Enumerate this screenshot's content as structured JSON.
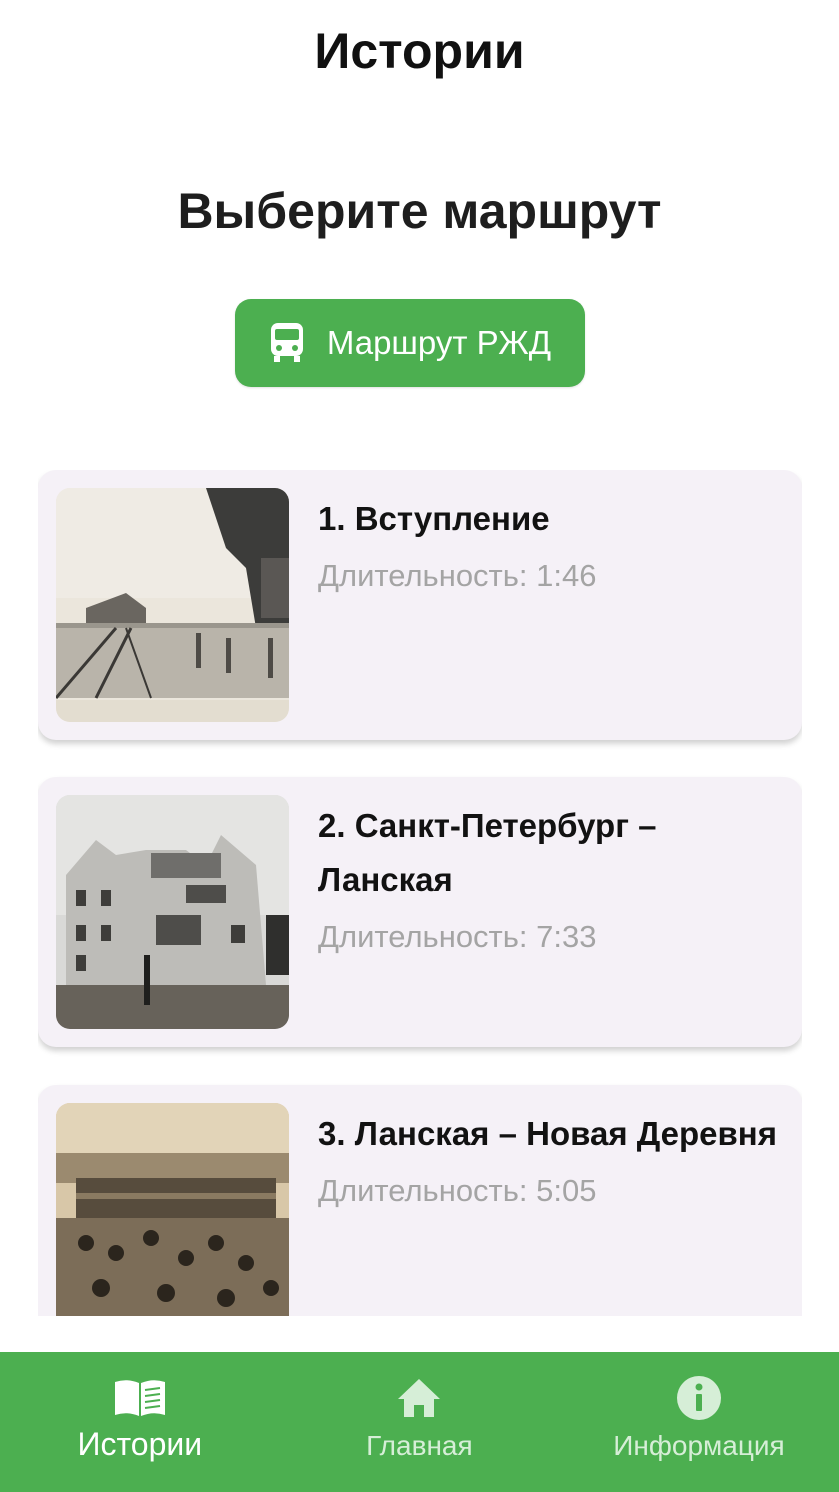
{
  "header": {
    "title": "Истории"
  },
  "section": {
    "title": "Выберите маршрут"
  },
  "route_button": {
    "label": "Маршрут РЖД",
    "icon": "train-icon"
  },
  "stories": [
    {
      "title": "1. Вступление",
      "duration": "Длительность: 1:46",
      "image": "railway-station-photo"
    },
    {
      "title": "2. Санкт-Петербург – Ланская",
      "duration": "Длительность: 7:33",
      "image": "building-photo"
    },
    {
      "title": "3. Ланская – Новая Деревня",
      "duration": "Длительность: 5:05",
      "image": "crowd-platform-photo"
    }
  ],
  "bottom_nav": {
    "items": [
      {
        "label": "Истории",
        "icon": "book-icon",
        "active": true
      },
      {
        "label": "Главная",
        "icon": "home-icon",
        "active": false
      },
      {
        "label": "Информация",
        "icon": "info-icon",
        "active": false
      }
    ]
  },
  "colors": {
    "accent": "#4caf50",
    "card_bg": "#f5f1f7",
    "muted_text": "#a4a4a4"
  }
}
